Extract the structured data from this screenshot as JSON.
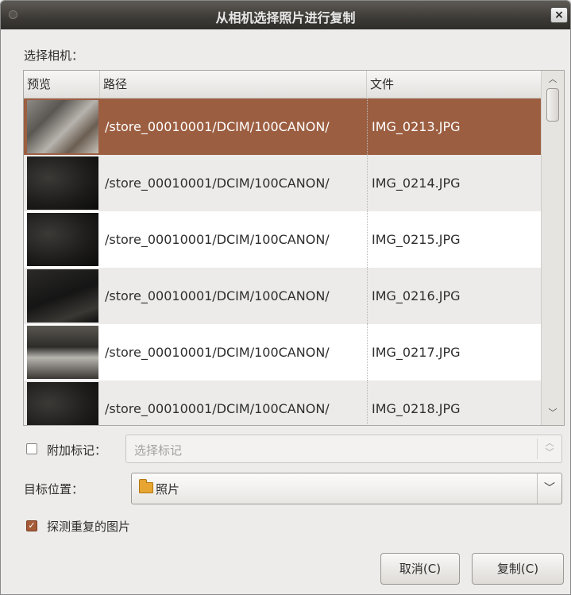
{
  "window": {
    "title": "从相机选择照片进行复制",
    "close_glyph": "×"
  },
  "camera_label": "选择相机：",
  "list": {
    "columns": [
      "预览",
      "路径",
      "文件"
    ],
    "rows": [
      {
        "path": "/store_00010001/DCIM/100CANON/",
        "file": "IMG_0213.JPG",
        "selected": true,
        "thumb": "thumb-rock-cliff"
      },
      {
        "path": "/store_00010001/DCIM/100CANON/",
        "file": "IMG_0214.JPG",
        "selected": false,
        "thumb": "thumb-dark-cave"
      },
      {
        "path": "/store_00010001/DCIM/100CANON/",
        "file": "IMG_0215.JPG",
        "selected": false,
        "thumb": "thumb-dark-cave"
      },
      {
        "path": "/store_00010001/DCIM/100CANON/",
        "file": "IMG_0216.JPG",
        "selected": false,
        "thumb": "thumb-cave-path"
      },
      {
        "path": "/store_00010001/DCIM/100CANON/",
        "file": "IMG_0217.JPG",
        "selected": false,
        "thumb": "thumb-person-cave"
      },
      {
        "path": "/store_00010001/DCIM/100CANON/",
        "file": "IMG_0218.JPG",
        "selected": false,
        "thumb": "thumb-dark-cave"
      }
    ]
  },
  "tag": {
    "label": "附加标记：",
    "placeholder": "选择标记",
    "checked": false
  },
  "destination": {
    "label": "目标位置：",
    "value": "照片",
    "icon": "folder-icon"
  },
  "detect_duplicates": {
    "label": "探测重复的图片",
    "checked": true
  },
  "buttons": {
    "cancel": "取消(C)",
    "copy": "复制(C)"
  },
  "colors": {
    "selection": "#9c5e41",
    "titlebar": "#3d3a36"
  }
}
